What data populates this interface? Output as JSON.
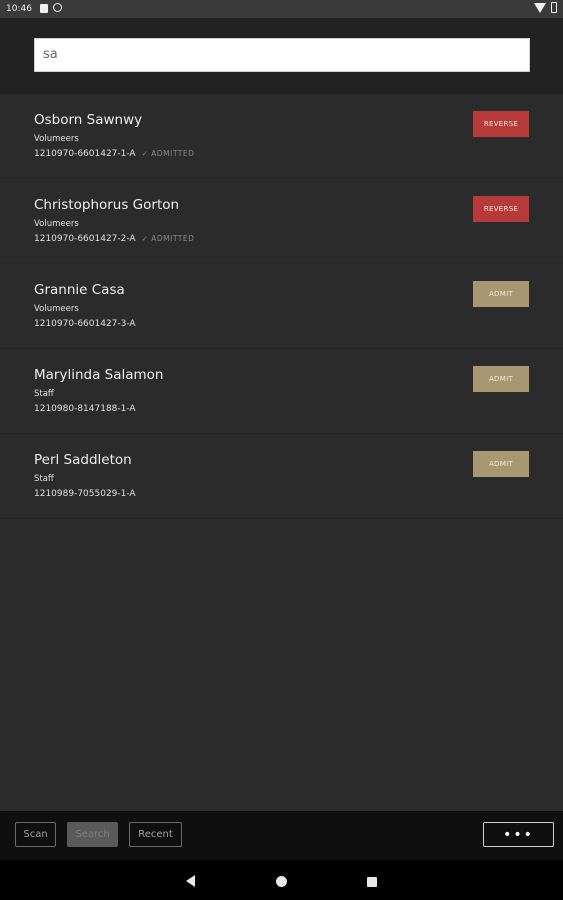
{
  "status_bar": {
    "time": "10:46"
  },
  "search": {
    "value": "sa"
  },
  "results": [
    {
      "name": "Osborn Sawnwy",
      "group": "Volumeers",
      "code": "1210970-6601427-1-A",
      "status": "✓ ADMITTED",
      "action": "REVERSE",
      "action_color": "#b63a3a"
    },
    {
      "name": "Christophorus Gorton",
      "group": "Volumeers",
      "code": "1210970-6601427-2-A",
      "status": "✓ ADMITTED",
      "action": "REVERSE",
      "action_color": "#b63a3a"
    },
    {
      "name": "Grannie Casa",
      "group": "Volumeers",
      "code": "1210970-6601427-3-A",
      "status": "",
      "action": "ADMIT",
      "action_color": "#a89872"
    },
    {
      "name": "Marylinda Salamon",
      "group": "Staff",
      "code": "1210980-8147188-1-A",
      "status": "",
      "action": "ADMIT",
      "action_color": "#a89872"
    },
    {
      "name": "Perl Saddleton",
      "group": "Staff",
      "code": "1210989-7055029-1-A",
      "status": "",
      "action": "ADMIT",
      "action_color": "#a89872"
    }
  ],
  "bottom_bar": {
    "tabs": [
      {
        "label": "Scan"
      },
      {
        "label": "Search"
      },
      {
        "label": "Recent"
      }
    ],
    "more_label": "•••"
  },
  "nav_bar": {
    "icons": [
      "back-icon",
      "home-icon",
      "recents-icon"
    ]
  }
}
